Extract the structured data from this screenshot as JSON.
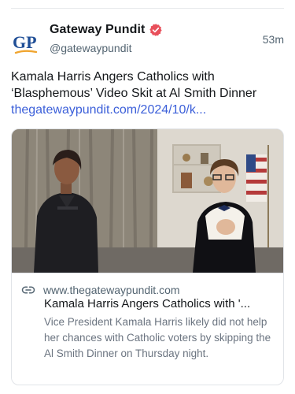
{
  "account": {
    "avatar_initials": "GP",
    "display_name": "Gateway Pundit",
    "handle": "@gatewaypundit",
    "verified_color": "#e8505b"
  },
  "post": {
    "timestamp": "53m",
    "text": "Kamala Harris Angers Catholics with ‘Blasphemous’ Video Skit at Al Smith Dinner",
    "link_text": "thegatewaypundit.com/2024/10/k..."
  },
  "card": {
    "domain": "www.thegatewaypundit.com",
    "title": "Kamala Harris Angers Catholics with '...",
    "description": "Vice President Kamala Harris likely did not help her chances with Catholic voters by skipping the Al Smith Dinner on Thursday night."
  },
  "icons": {
    "verified": "verified-badge-icon",
    "link": "link-icon"
  },
  "colors": {
    "link": "#3b5fd9",
    "avatar_blue": "#1f4e96",
    "avatar_orange": "#f0a530"
  }
}
